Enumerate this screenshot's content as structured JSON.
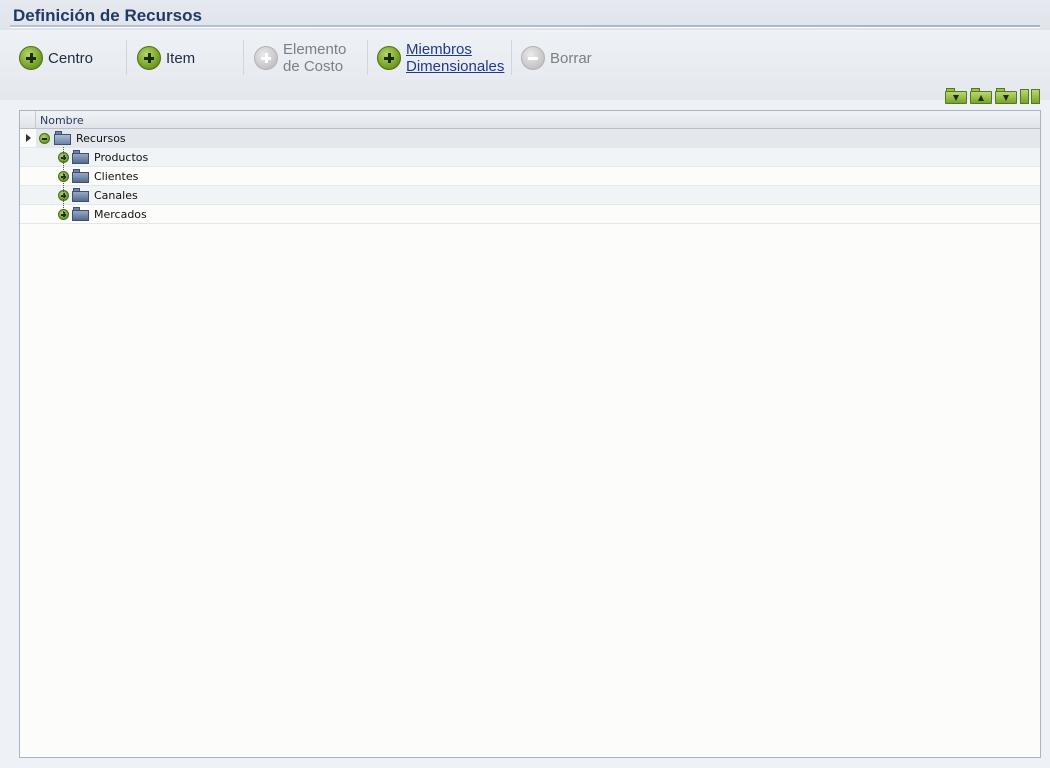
{
  "page": {
    "title": "Definición de Recursos"
  },
  "toolbar": {
    "centro": {
      "label": "Centro",
      "icon": "add-circle-icon"
    },
    "item": {
      "label": "Item",
      "icon": "add-circle-icon"
    },
    "elemento_line1": "Elemento",
    "elemento_line2": "de Costo",
    "miembros_line1": "Miembros",
    "miembros_line2": "Dimensionales",
    "borrar": {
      "label": "Borrar",
      "icon": "remove-circle-icon"
    }
  },
  "tree": {
    "column_header": "Nombre",
    "root": {
      "label": "Recursos",
      "icon": "folder-open-icon",
      "expanded": true
    },
    "children": [
      {
        "label": "Productos",
        "icon": "folder-icon"
      },
      {
        "label": "Clientes",
        "icon": "folder-icon"
      },
      {
        "label": "Canales",
        "icon": "folder-icon"
      },
      {
        "label": "Mercados",
        "icon": "folder-icon"
      }
    ]
  },
  "colors": {
    "title": "#1f3a66",
    "accent_green": "#6c9a1f",
    "folder_blue": "#56698a",
    "link": "#1f3a8a"
  }
}
